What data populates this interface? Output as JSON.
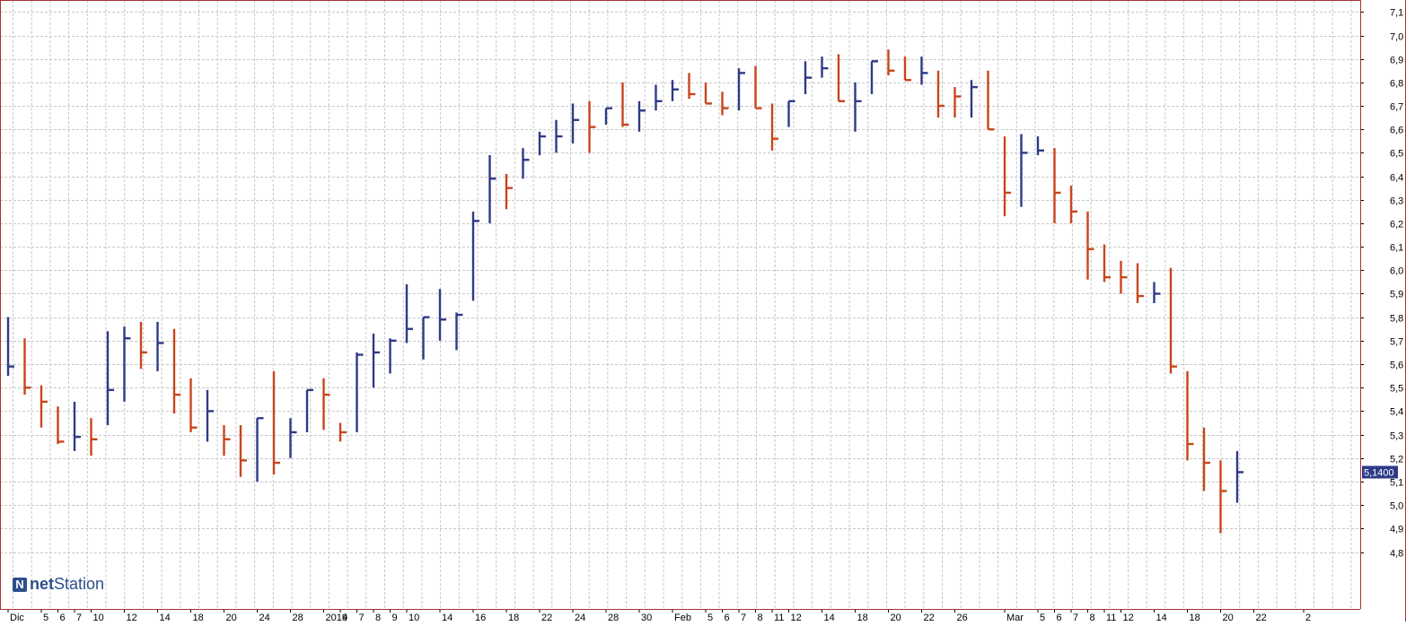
{
  "colors": {
    "up": "#2e3a87",
    "down": "#c9451c",
    "grid": "#c8c8c8",
    "border": "#a83232",
    "price_tag_bg": "#2e3a87"
  },
  "logo": {
    "prefix": "net",
    "suffix": "Station",
    "icon": "netstation-logo-icon"
  },
  "chart_data": {
    "type": "ohlc",
    "ylim": [
      4.77,
      7.13
    ],
    "yticks": [
      "7,1",
      "7,0",
      "6,9",
      "6,8",
      "6,7",
      "6,6",
      "6,5",
      "6,4",
      "6,3",
      "6,2",
      "6,1",
      "6,0",
      "5,9",
      "5,8",
      "5,7",
      "5,6",
      "5,5",
      "5,4",
      "5,3",
      "5,2",
      "5,1",
      "5,0",
      "4,9",
      "4,8"
    ],
    "last_price": "5,1400",
    "grid": true,
    "xtick_labels": [
      {
        "i": 0,
        "label": "Dic"
      },
      {
        "i": 2,
        "label": "5"
      },
      {
        "i": 3,
        "label": "6"
      },
      {
        "i": 4,
        "label": "7"
      },
      {
        "i": 5,
        "label": "10"
      },
      {
        "i": 7,
        "label": "12"
      },
      {
        "i": 9,
        "label": "14"
      },
      {
        "i": 11,
        "label": "18"
      },
      {
        "i": 13,
        "label": "20"
      },
      {
        "i": 15,
        "label": "24"
      },
      {
        "i": 17,
        "label": "28"
      },
      {
        "i": 19,
        "label": "2019"
      },
      {
        "i": 20,
        "label": "4"
      },
      {
        "i": 21,
        "label": "7"
      },
      {
        "i": 22,
        "label": "8"
      },
      {
        "i": 23,
        "label": "9"
      },
      {
        "i": 24,
        "label": "10"
      },
      {
        "i": 26,
        "label": "14"
      },
      {
        "i": 28,
        "label": "16"
      },
      {
        "i": 30,
        "label": "18"
      },
      {
        "i": 32,
        "label": "22"
      },
      {
        "i": 34,
        "label": "24"
      },
      {
        "i": 36,
        "label": "28"
      },
      {
        "i": 38,
        "label": "30"
      },
      {
        "i": 40,
        "label": "Feb"
      },
      {
        "i": 42,
        "label": "5"
      },
      {
        "i": 43,
        "label": "6"
      },
      {
        "i": 44,
        "label": "7"
      },
      {
        "i": 45,
        "label": "8"
      },
      {
        "i": 46,
        "label": "11"
      },
      {
        "i": 47,
        "label": "12"
      },
      {
        "i": 49,
        "label": "14"
      },
      {
        "i": 51,
        "label": "18"
      },
      {
        "i": 53,
        "label": "20"
      },
      {
        "i": 55,
        "label": "22"
      },
      {
        "i": 57,
        "label": "26"
      },
      {
        "i": 60,
        "label": "Mar"
      },
      {
        "i": 62,
        "label": "5"
      },
      {
        "i": 63,
        "label": "6"
      },
      {
        "i": 64,
        "label": "7"
      },
      {
        "i": 65,
        "label": "8"
      },
      {
        "i": 66,
        "label": "11"
      },
      {
        "i": 67,
        "label": "12"
      },
      {
        "i": 69,
        "label": "14"
      },
      {
        "i": 71,
        "label": "18"
      },
      {
        "i": 73,
        "label": "20"
      },
      {
        "i": 75,
        "label": "22"
      },
      {
        "i": 78,
        "label": "2"
      }
    ],
    "bars": [
      {
        "h": 5.8,
        "l": 5.55,
        "c": 5.59,
        "up": true
      },
      {
        "h": 5.71,
        "l": 5.47,
        "c": 5.5,
        "up": false
      },
      {
        "h": 5.51,
        "l": 5.33,
        "c": 5.44,
        "up": false
      },
      {
        "h": 5.42,
        "l": 5.26,
        "c": 5.27,
        "up": false
      },
      {
        "h": 5.44,
        "l": 5.23,
        "c": 5.29,
        "up": true
      },
      {
        "h": 5.37,
        "l": 5.21,
        "c": 5.28,
        "up": false
      },
      {
        "h": 5.74,
        "l": 5.34,
        "c": 5.49,
        "up": true
      },
      {
        "h": 5.76,
        "l": 5.44,
        "c": 5.71,
        "up": true
      },
      {
        "h": 5.78,
        "l": 5.58,
        "c": 5.65,
        "up": false
      },
      {
        "h": 5.78,
        "l": 5.57,
        "c": 5.69,
        "up": true
      },
      {
        "h": 5.75,
        "l": 5.39,
        "c": 5.47,
        "up": false
      },
      {
        "h": 5.54,
        "l": 5.31,
        "c": 5.33,
        "up": false
      },
      {
        "h": 5.49,
        "l": 5.27,
        "c": 5.4,
        "up": true
      },
      {
        "h": 5.34,
        "l": 5.21,
        "c": 5.28,
        "up": false
      },
      {
        "h": 5.34,
        "l": 5.12,
        "c": 5.19,
        "up": false
      },
      {
        "h": 5.37,
        "l": 5.1,
        "c": 5.37,
        "up": true
      },
      {
        "h": 5.57,
        "l": 5.13,
        "c": 5.18,
        "up": false
      },
      {
        "h": 5.37,
        "l": 5.2,
        "c": 5.31,
        "up": true
      },
      {
        "h": 5.49,
        "l": 5.31,
        "c": 5.49,
        "up": true
      },
      {
        "h": 5.54,
        "l": 5.32,
        "c": 5.47,
        "up": false
      },
      {
        "h": 5.35,
        "l": 5.27,
        "c": 5.31,
        "up": false
      },
      {
        "h": 5.65,
        "l": 5.31,
        "c": 5.64,
        "up": true
      },
      {
        "h": 5.73,
        "l": 5.5,
        "c": 5.65,
        "up": true
      },
      {
        "h": 5.71,
        "l": 5.56,
        "c": 5.7,
        "up": true
      },
      {
        "h": 5.94,
        "l": 5.69,
        "c": 5.75,
        "up": true
      },
      {
        "h": 5.8,
        "l": 5.62,
        "c": 5.8,
        "up": true
      },
      {
        "h": 5.92,
        "l": 5.7,
        "c": 5.79,
        "up": true
      },
      {
        "h": 5.82,
        "l": 5.66,
        "c": 5.81,
        "up": true
      },
      {
        "h": 6.25,
        "l": 5.87,
        "c": 6.21,
        "up": true
      },
      {
        "h": 6.49,
        "l": 6.2,
        "c": 6.39,
        "up": true
      },
      {
        "h": 6.41,
        "l": 6.26,
        "c": 6.35,
        "up": false
      },
      {
        "h": 6.52,
        "l": 6.39,
        "c": 6.47,
        "up": true
      },
      {
        "h": 6.59,
        "l": 6.49,
        "c": 6.57,
        "up": true
      },
      {
        "h": 6.64,
        "l": 6.5,
        "c": 6.57,
        "up": true
      },
      {
        "h": 6.71,
        "l": 6.54,
        "c": 6.64,
        "up": true
      },
      {
        "h": 6.72,
        "l": 6.5,
        "c": 6.61,
        "up": false
      },
      {
        "h": 6.69,
        "l": 6.62,
        "c": 6.69,
        "up": true
      },
      {
        "h": 6.8,
        "l": 6.61,
        "c": 6.62,
        "up": false
      },
      {
        "h": 6.72,
        "l": 6.59,
        "c": 6.68,
        "up": true
      },
      {
        "h": 6.79,
        "l": 6.68,
        "c": 6.72,
        "up": true
      },
      {
        "h": 6.81,
        "l": 6.72,
        "c": 6.77,
        "up": true
      },
      {
        "h": 6.84,
        "l": 6.73,
        "c": 6.75,
        "up": false
      },
      {
        "h": 6.8,
        "l": 6.71,
        "c": 6.71,
        "up": false
      },
      {
        "h": 6.76,
        "l": 6.66,
        "c": 6.69,
        "up": false
      },
      {
        "h": 6.86,
        "l": 6.68,
        "c": 6.84,
        "up": true
      },
      {
        "h": 6.87,
        "l": 6.69,
        "c": 6.69,
        "up": false
      },
      {
        "h": 6.71,
        "l": 6.51,
        "c": 6.56,
        "up": false
      },
      {
        "h": 6.72,
        "l": 6.61,
        "c": 6.72,
        "up": true
      },
      {
        "h": 6.89,
        "l": 6.75,
        "c": 6.82,
        "up": true
      },
      {
        "h": 6.91,
        "l": 6.82,
        "c": 6.86,
        "up": true
      },
      {
        "h": 6.92,
        "l": 6.72,
        "c": 6.72,
        "up": false
      },
      {
        "h": 6.8,
        "l": 6.59,
        "c": 6.72,
        "up": true
      },
      {
        "h": 6.89,
        "l": 6.75,
        "c": 6.89,
        "up": true
      },
      {
        "h": 6.94,
        "l": 6.83,
        "c": 6.85,
        "up": false
      },
      {
        "h": 6.91,
        "l": 6.81,
        "c": 6.81,
        "up": false
      },
      {
        "h": 6.91,
        "l": 6.79,
        "c": 6.84,
        "up": true
      },
      {
        "h": 6.85,
        "l": 6.65,
        "c": 6.7,
        "up": false
      },
      {
        "h": 6.78,
        "l": 6.65,
        "c": 6.74,
        "up": false
      },
      {
        "h": 6.81,
        "l": 6.65,
        "c": 6.78,
        "up": true
      },
      {
        "h": 6.85,
        "l": 6.6,
        "c": 6.6,
        "up": false
      },
      {
        "h": 6.57,
        "l": 6.23,
        "c": 6.33,
        "up": false
      },
      {
        "h": 6.58,
        "l": 6.27,
        "c": 6.5,
        "up": true
      },
      {
        "h": 6.57,
        "l": 6.49,
        "c": 6.51,
        "up": true
      },
      {
        "h": 6.52,
        "l": 6.2,
        "c": 6.33,
        "up": false
      },
      {
        "h": 6.36,
        "l": 6.2,
        "c": 6.25,
        "up": false
      },
      {
        "h": 6.25,
        "l": 5.96,
        "c": 6.09,
        "up": false
      },
      {
        "h": 6.11,
        "l": 5.95,
        "c": 5.97,
        "up": false
      },
      {
        "h": 6.04,
        "l": 5.9,
        "c": 5.97,
        "up": false
      },
      {
        "h": 6.03,
        "l": 5.86,
        "c": 5.89,
        "up": false
      },
      {
        "h": 5.95,
        "l": 5.86,
        "c": 5.9,
        "up": true
      },
      {
        "h": 6.01,
        "l": 5.56,
        "c": 5.59,
        "up": false
      },
      {
        "h": 5.57,
        "l": 5.19,
        "c": 5.26,
        "up": false
      },
      {
        "h": 5.33,
        "l": 5.06,
        "c": 5.18,
        "up": false
      },
      {
        "h": 5.19,
        "l": 4.88,
        "c": 5.06,
        "up": false
      },
      {
        "h": 5.23,
        "l": 5.01,
        "c": 5.14,
        "up": true
      }
    ]
  }
}
